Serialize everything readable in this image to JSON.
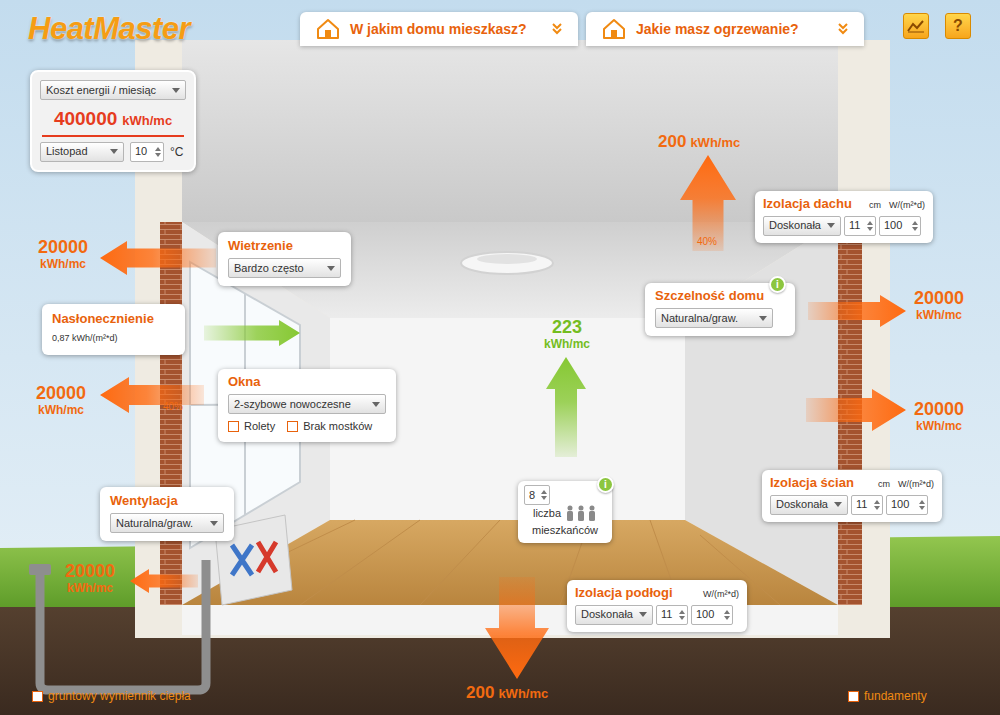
{
  "logo": "HeatMaster",
  "tabs": [
    {
      "label": "W jakim domu mieszkasz?"
    },
    {
      "label": "Jakie masz ogrzewanie?"
    }
  ],
  "help": "?",
  "cost_panel": {
    "mode": "Koszt energii / miesiąc",
    "value": "400000",
    "unit": "kWh/mc",
    "month": "Listopad",
    "temperature": "10",
    "temperature_unit": "°C"
  },
  "airing": {
    "label": "Wietrzenie",
    "select": "Bardzo często",
    "flow": {
      "kind": "loss",
      "value": "20000",
      "unit": "kWh/mc"
    }
  },
  "insolation": {
    "label": "Nasłonecznienie",
    "reading": "0,87 kWh/(m²*d)",
    "flow": {
      "kind": "gain"
    }
  },
  "windows": {
    "label": "Okna",
    "select": "2-szybowe nowoczesne",
    "options": [
      {
        "label": "Rolety",
        "checked": false
      },
      {
        "label": "Brak mostków",
        "checked": false
      }
    ],
    "flow": {
      "kind": "loss",
      "value": "20000",
      "unit": "kWh/mc",
      "percent": "40%"
    }
  },
  "ventilation": {
    "label": "Wentylacja",
    "select": "Naturalna/graw.",
    "flow": {
      "kind": "loss",
      "value": "20000",
      "unit": "kWh/mc"
    }
  },
  "roof": {
    "label": "Izolacja dachu",
    "unit_thickness": "cm",
    "unit_coefficient": "W/(m²*d)",
    "select": "Doskonała",
    "thickness": "11",
    "coefficient": "100",
    "flow": {
      "kind": "loss",
      "value": "200",
      "unit": "kWh/mc",
      "percent": "40%"
    }
  },
  "airtightness": {
    "label": "Szczelność domu",
    "select": "Naturalna/graw.",
    "info": "i",
    "flow": {
      "kind": "loss",
      "value": "20000",
      "unit": "kWh/mc"
    }
  },
  "walls": {
    "label": "Izolacja ścian",
    "unit_thickness": "cm",
    "unit_coefficient": "W/(m²*d)",
    "select": "Doskonała",
    "thickness": "11",
    "coefficient": "100",
    "flow": {
      "kind": "loss",
      "value": "20000",
      "unit": "kWh/mc"
    }
  },
  "occupants": {
    "count": "8",
    "label_top": "liczba",
    "label_bottom": "mieszkańców",
    "info": "i",
    "flow": {
      "kind": "gain",
      "value": "223",
      "unit": "kWh/mc"
    }
  },
  "floor": {
    "label": "Izolacja podłogi",
    "unit_coefficient": "W/(m²*d)",
    "select": "Doskonała",
    "thickness": "11",
    "coefficient": "100",
    "flow": {
      "kind": "loss",
      "value": "200",
      "unit": "kWh/mc"
    }
  },
  "bottom_options": [
    {
      "label": "gruntowy wymiennik ciepła",
      "checked": false
    },
    {
      "label": "fundamenty",
      "checked": false
    }
  ]
}
